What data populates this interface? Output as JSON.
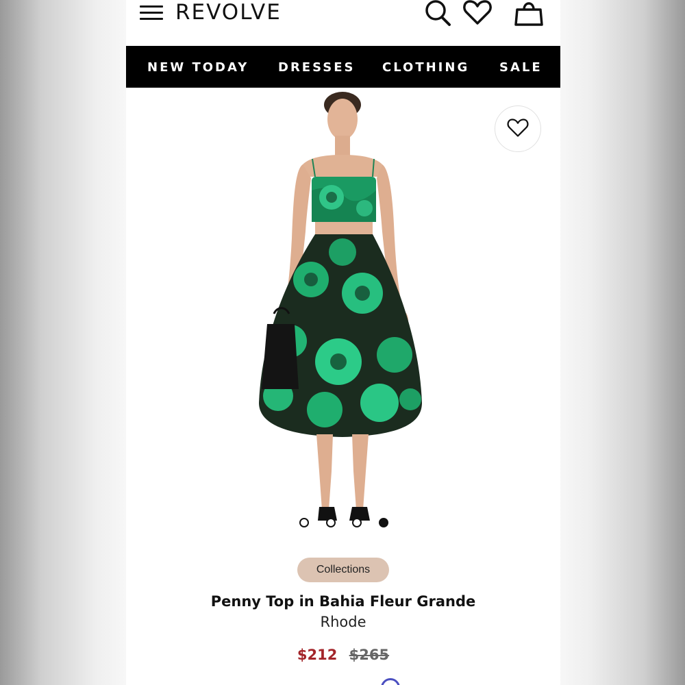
{
  "header": {
    "logo": "REVOLVE",
    "icons": [
      "menu-icon",
      "search-icon",
      "heart-icon",
      "shopping-bag-icon"
    ]
  },
  "nav": {
    "items": [
      {
        "label": "NEW TODAY"
      },
      {
        "label": "DRESSES"
      },
      {
        "label": "CLOTHING"
      },
      {
        "label": "SALE"
      }
    ]
  },
  "gallery": {
    "image_count": 4,
    "active_index": 3,
    "skirt_color": "#1fa86a",
    "skirt_dark": "#152418"
  },
  "product": {
    "tag": "Collections",
    "title": "Penny Top in Bahia Fleur Grande",
    "brand": "Rhode",
    "sale_price": "$212",
    "original_price": "$265"
  },
  "colors": {
    "sale": "#a3252a",
    "tag_bg": "#dcc3b2",
    "nav_bg": "#000000"
  }
}
